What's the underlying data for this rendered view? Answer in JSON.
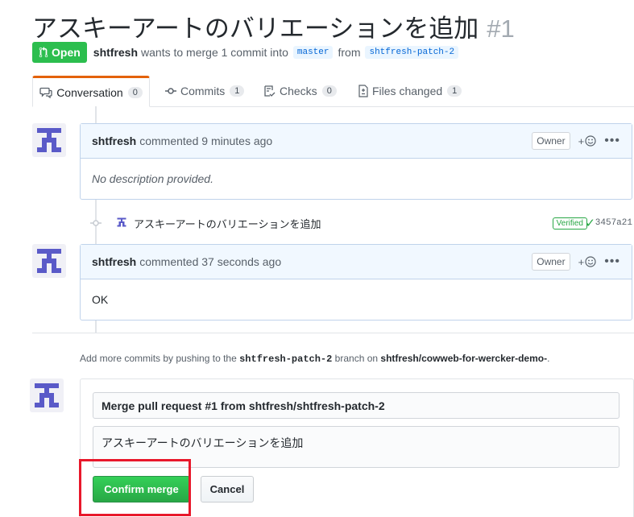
{
  "pr": {
    "title": "アスキーアートのバリエーションを追加",
    "number": "#1",
    "state": "Open",
    "author": "shtfresh",
    "meta_text": "wants to merge 1 commit into",
    "base_branch": "master",
    "from_text": "from",
    "head_branch": "shtfresh-patch-2"
  },
  "tabs": [
    {
      "label": "Conversation",
      "count": "0",
      "icon": "comment-icon"
    },
    {
      "label": "Commits",
      "count": "1",
      "icon": "commit-icon"
    },
    {
      "label": "Checks",
      "count": "0",
      "icon": "checklist-icon"
    },
    {
      "label": "Files changed",
      "count": "1",
      "icon": "file-diff-icon"
    }
  ],
  "comments": [
    {
      "author": "shtfresh",
      "action": "commented 9 minutes ago",
      "badge": "Owner",
      "body": "No description provided."
    },
    {
      "author": "shtfresh",
      "action": "commented 37 seconds ago",
      "badge": "Owner",
      "body": "OK"
    }
  ],
  "commit": {
    "message": "アスキーアートのバリエーションを追加",
    "verified": "Verified",
    "sha": "3457a21"
  },
  "help": {
    "prefix": "Add more commits by pushing to the",
    "branch": "shtfresh-patch-2",
    "middle": "branch on",
    "repo": "shtfresh/cowweb-for-wercker-demo-",
    "suffix": "."
  },
  "merge": {
    "title_value": "Merge pull request #1 from shtfresh/shtfresh-patch-2",
    "body_value": "アスキーアートのバリエーションを追加",
    "confirm_label": "Confirm merge",
    "cancel_label": "Cancel"
  },
  "colors": {
    "open_green": "#2cbe4e",
    "tab_accent": "#e36209",
    "highlight_red": "#e8182b",
    "avatar_purple": "#5a5ac8"
  }
}
